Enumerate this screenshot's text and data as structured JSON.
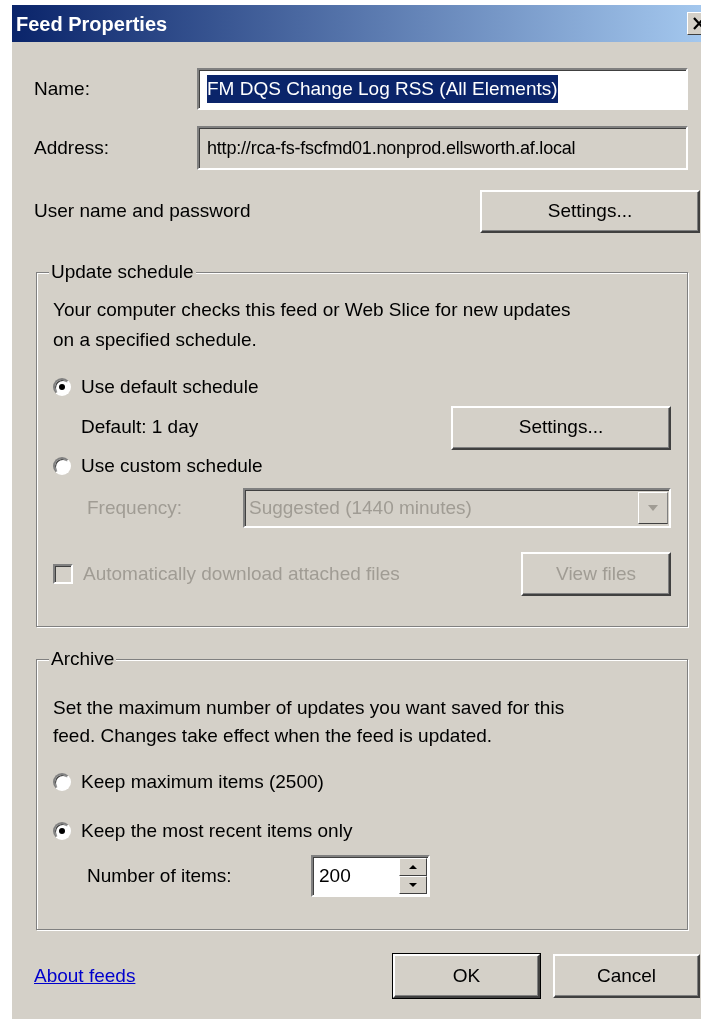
{
  "window": {
    "title": "Feed Properties"
  },
  "name_field": {
    "label": "Name:",
    "value": "FM DQS Change Log RSS (All Elements)",
    "highlighted": true
  },
  "address_field": {
    "label": "Address:",
    "value": "http://rca-fs-fscfmd01.nonprod.ellsworth.af.local",
    "disabled": true
  },
  "credentials": {
    "label": "User name and password",
    "button": "Settings..."
  },
  "update_schedule": {
    "title": "Update schedule",
    "description": "Your computer checks this feed or Web Slice for new updates on a specified schedule.",
    "options": [
      {
        "label": "Use default schedule",
        "selected": true
      },
      {
        "label": "Use custom schedule",
        "selected": false
      }
    ],
    "default_text": "Default: 1 day",
    "settings_button": "Settings...",
    "frequency": {
      "label": "Frequency:",
      "value": "Suggested (1440 minutes)",
      "disabled": true
    },
    "auto_download": {
      "label": "Automatically download attached files",
      "checked": false,
      "disabled": true
    },
    "view_files": {
      "label": "View files",
      "disabled": true
    }
  },
  "archive": {
    "title": "Archive",
    "description": "Set the maximum number of updates you want saved for this feed. Changes take effect when the feed is updated.",
    "options": [
      {
        "label": "Keep maximum items (2500)",
        "selected": false
      },
      {
        "label": "Keep the most recent items only",
        "selected": true
      }
    ],
    "number": {
      "label": "Number of items:",
      "value": "200"
    }
  },
  "footer": {
    "link": "About feeds",
    "buttons": [
      {
        "label": "OK",
        "default": true
      },
      {
        "label": "Cancel",
        "default": false
      }
    ]
  }
}
